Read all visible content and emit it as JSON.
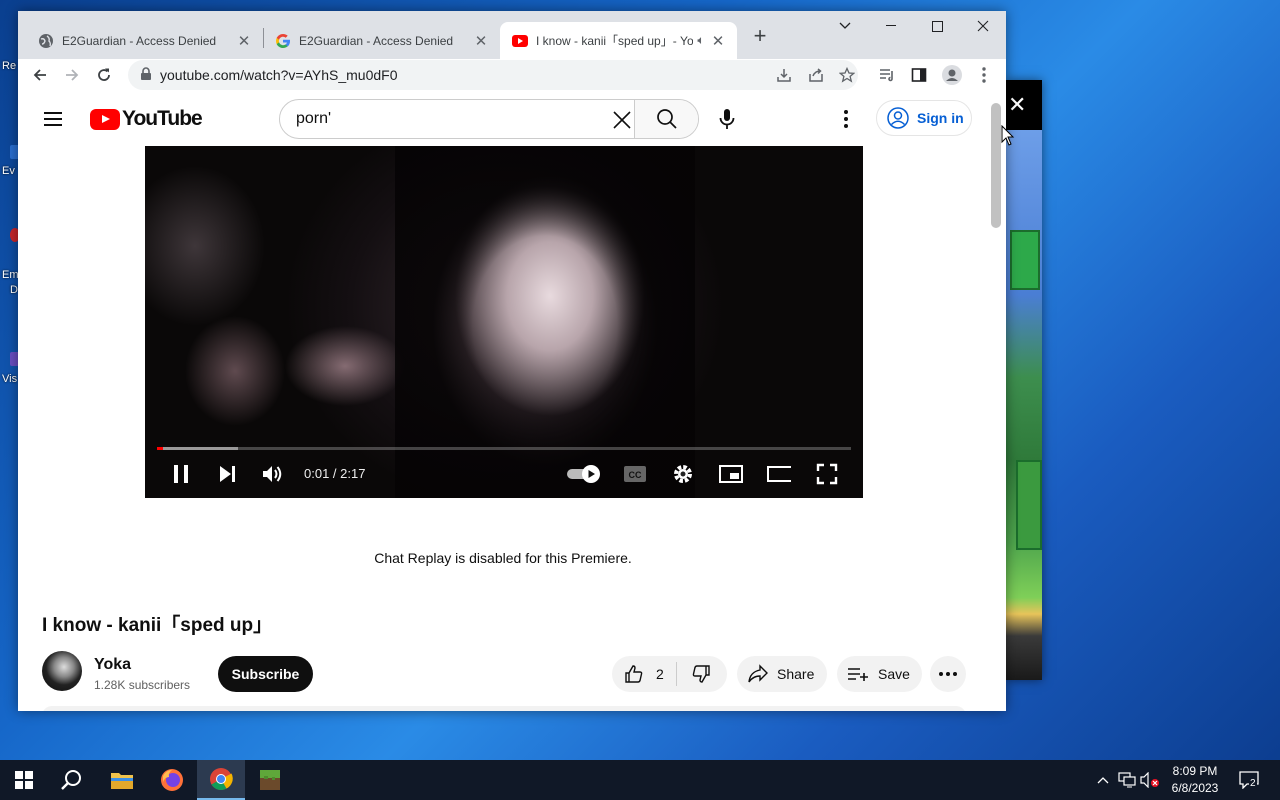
{
  "desktop": {
    "fragments": [
      "Re",
      "Ev",
      "Em",
      "D",
      "Vis"
    ]
  },
  "browser": {
    "tabs": [
      {
        "title": "E2Guardian - Access Denied",
        "icon": "globe-icon"
      },
      {
        "title": "E2Guardian - Access Denied",
        "icon": "google-icon"
      },
      {
        "title": "I know - kanii「sped up」- Yo",
        "icon": "youtube-icon",
        "audio": true
      }
    ],
    "url": "youtube.com/watch?v=AYhS_mu0dF0"
  },
  "youtube": {
    "logo_text": "YouTube",
    "search_query": "porn'",
    "sign_in": "Sign in",
    "player": {
      "time": "0:01 / 2:17",
      "progress_fraction": 0.008,
      "buffered_fraction": 0.116
    },
    "chat_replay": "Chat Replay is disabled for this Premiere.",
    "video_title": "I know - kanii「sped up」",
    "channel": {
      "name": "Yoka",
      "subscribers": "1.28K subscribers"
    },
    "subscribe": "Subscribe",
    "likes": "2",
    "share": "Share",
    "save": "Save"
  },
  "taskbar": {
    "time": "8:09 PM",
    "date": "6/8/2023",
    "notifications": "2"
  },
  "colors": {
    "yt_red": "#ff0000",
    "link_blue": "#065fd4",
    "taskbar": "#101827"
  }
}
